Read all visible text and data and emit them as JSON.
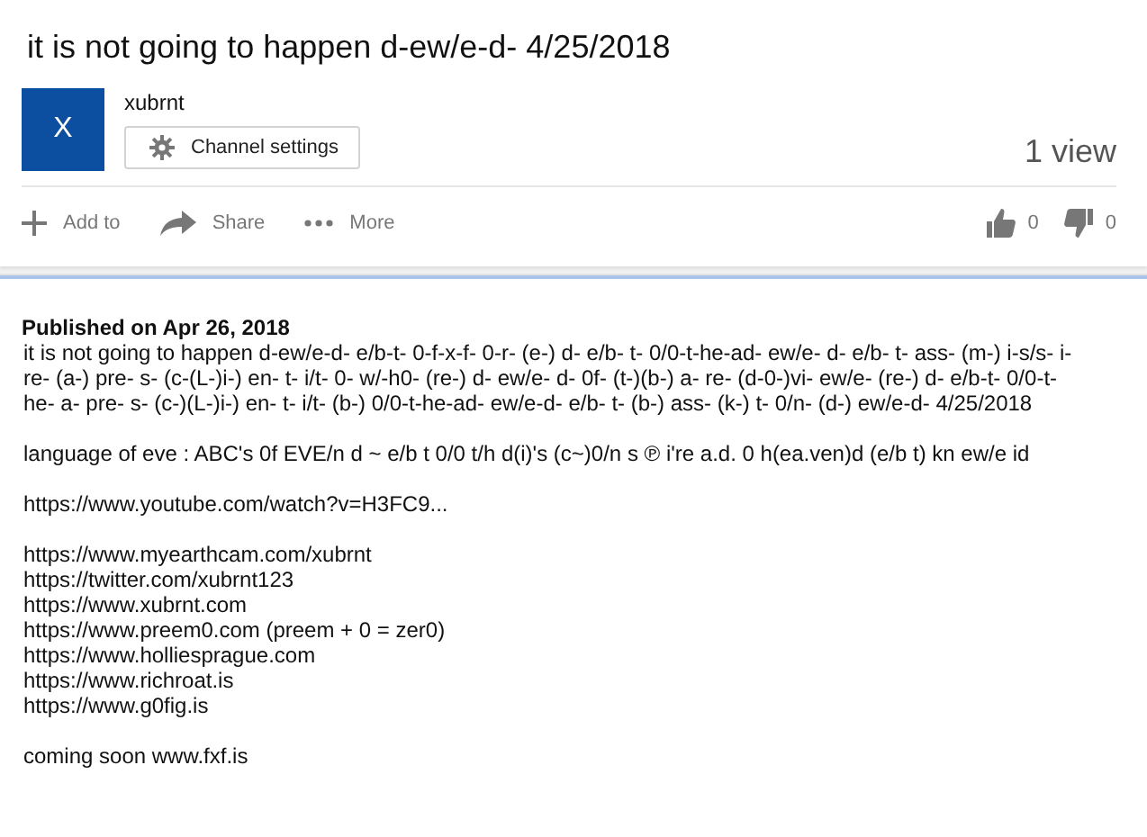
{
  "video": {
    "title": "it is not going to happen d-ew/e-d- 4/25/2018",
    "channel": {
      "avatar_letter": "X",
      "name": "xubrnt",
      "settings_button": "Channel settings"
    },
    "views": "1 view",
    "actions": [
      {
        "kind": "add",
        "label": "Add to"
      },
      {
        "kind": "share",
        "label": "Share"
      },
      {
        "kind": "more",
        "label": "More"
      }
    ],
    "likes": "0",
    "dislikes": "0"
  },
  "description": {
    "published": "Published on Apr 26, 2018",
    "blocks": [
      [
        {
          "kind": "text",
          "text": "it is not going to happen d-ew/e-d- e/b-t- 0-f-x-f- 0-r- (e-) d- e/b- t- 0/0-t-he-ad- ew/e- d- e/b- t- ass- (m-) i-s/s- i- re- (a-) pre- s- (c-(L-)i-) en- t- i/t- 0- w/-h0- (re-) d- ew/e- d- 0f- (t-)(b-) a- re- (d-0-)vi- ew/e- (re-) d- e/b-t- 0/0-t- he- a- pre- s- (c-)(L-)i-) en- t- i/t- (b-) 0/0-t-he-ad- ew/e-d- e/b- t- (b-) ass- (k-) t- 0/n- (d-) ew/e-d- 4/25/2018"
        }
      ],
      [
        {
          "kind": "text",
          "text": "language of eve : ABC's 0f EVE/n d ~ e/b t 0/0 t/h d(i)'s (c~)0/n s ℗ i're a.d. 0 h(ea.ven)d (e/b t) kn ew/e id"
        }
      ],
      [
        {
          "kind": "link",
          "text": "https://www.youtube.com/watch?v=H3FC9..."
        }
      ],
      [
        {
          "kind": "link",
          "text": "https://www.myearthcam.com/xubrnt"
        },
        {
          "kind": "link",
          "text": "https://twitter.com/xubrnt123"
        },
        {
          "kind": "link",
          "text": "https://www.xubrnt.com"
        },
        {
          "kind": "text",
          "text": "https://www.preem0.com (preem + 0 = zer0)"
        },
        {
          "kind": "link",
          "text": "https://www.holliesprague.com"
        },
        {
          "kind": "link",
          "text": "https://www.richroat.is"
        },
        {
          "kind": "link",
          "text": "https://www.g0fig.is"
        }
      ],
      [
        {
          "kind": "text",
          "text": "coming soon www.fxf.is"
        }
      ]
    ]
  }
}
